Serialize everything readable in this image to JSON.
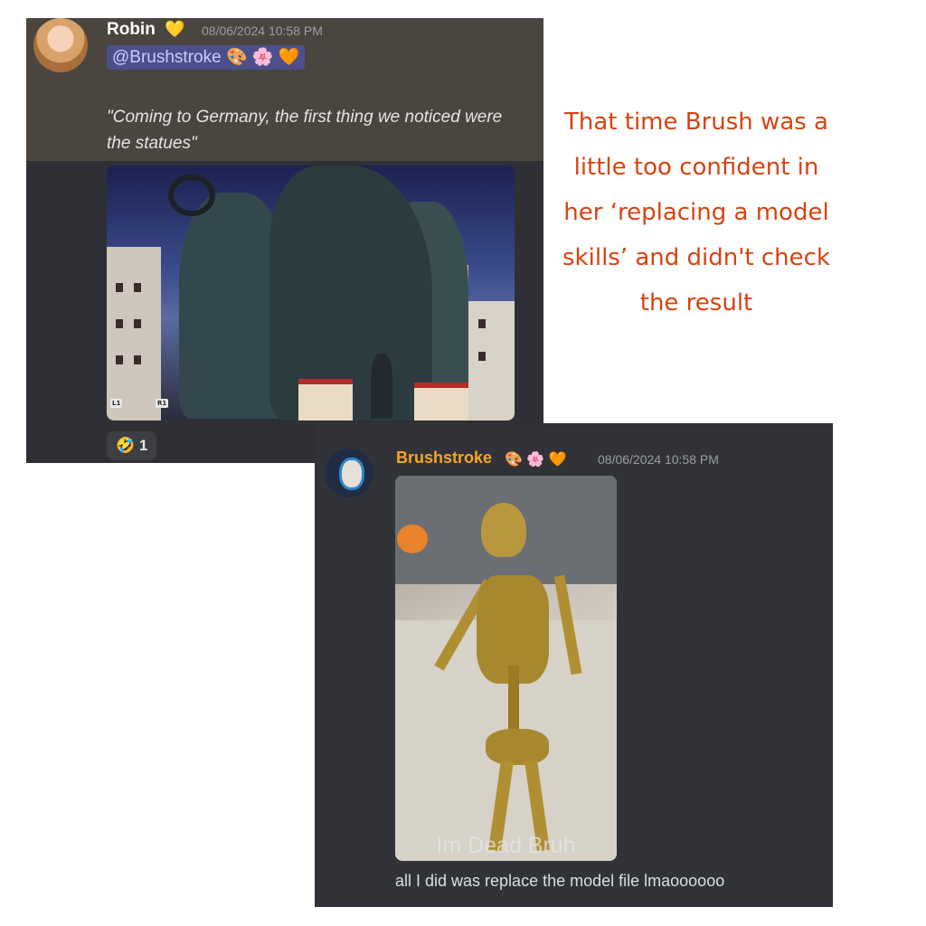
{
  "robin_message": {
    "username": "Robin",
    "user_badge_emoji": "💛",
    "timestamp": "08/06/2024 10:58 PM",
    "mention": "@Brushstroke",
    "mention_emojis": "🎨 🌸 🧡",
    "quote": "\"Coming to Germany, the first thing we noticed were the statues\"",
    "image_tags": {
      "left": "L1",
      "right": "R1"
    },
    "reaction": {
      "emoji": "🤣",
      "count": "1"
    }
  },
  "caption": "That time Brush was a\nlittle too confident in\nher ‘replacing a model\nskills’ and didn't check\nthe result",
  "brushstroke_message": {
    "username": "Brushstroke",
    "name_emojis": "🎨 🌸 🧡",
    "timestamp": "08/06/2024 10:58 PM",
    "image_overlay_text": "Im Dead Bruh",
    "text": "all I did was replace the model file lmaoooooo"
  },
  "colors": {
    "caption": "#d8430f",
    "robin_highlight_bg": "#4a463f",
    "chat_bg": "#313338",
    "brushstroke_name": "#f5a623",
    "mention_bg": "#4b4f8c"
  }
}
